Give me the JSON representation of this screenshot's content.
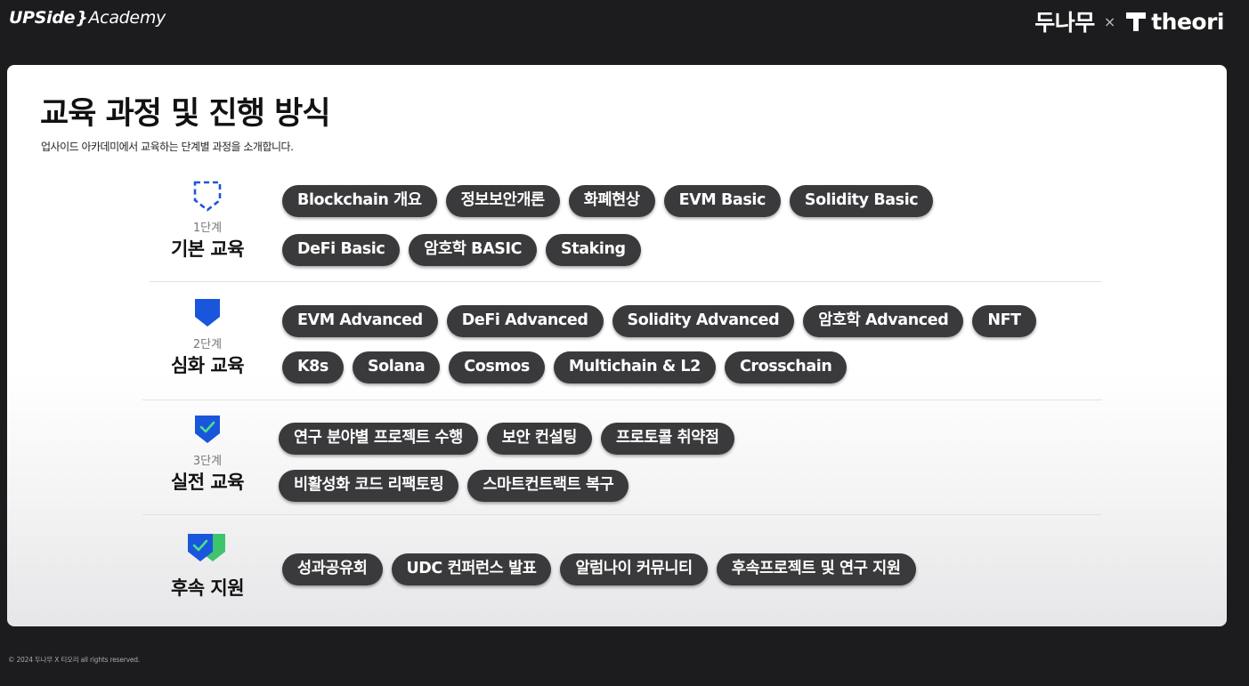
{
  "header": {
    "logo_brand": "UPSide",
    "logo_slash": "}",
    "logo_academy": "Academy",
    "partner_left": "두나무",
    "partner_sep": "×",
    "partner_right": "theori"
  },
  "card": {
    "title": "교육 과정 및 진행 방식",
    "subtitle": "업사이드 아카데미에서 교육하는 단계별 과정을 소개합니다."
  },
  "stages": [
    {
      "step": "1단계",
      "name": "기본 교육",
      "icon": "dashed-shield-icon",
      "rows": [
        [
          "Blockchain 개요",
          "정보보안개론",
          "화폐현상",
          "EVM Basic",
          "Solidity Basic"
        ],
        [
          "DeFi Basic",
          "암호학 BASIC",
          "Staking"
        ]
      ]
    },
    {
      "step": "2단계",
      "name": "심화 교육",
      "icon": "shield-icon",
      "rows": [
        [
          "EVM Advanced",
          "DeFi Advanced",
          "Solidity Advanced",
          "암호학 Advanced",
          "NFT"
        ],
        [
          "K8s",
          "Solana",
          "Cosmos",
          "Multichain & L2",
          "Crosschain"
        ]
      ]
    },
    {
      "step": "3단계",
      "name": "실전 교육",
      "icon": "shield-check-icon",
      "rows": [
        [
          "연구 분야별 프로젝트 수행",
          "보안 컨설팅",
          "프로토콜 취약점"
        ],
        [
          "비활성화 코드 리팩토링",
          "스마트컨트랙트 복구"
        ]
      ]
    },
    {
      "step": "",
      "name": "후속 지원",
      "icon": "double-shield-check-icon",
      "rows": [
        [
          "성과공유회",
          "UDC 컨퍼런스 발표",
          "알럼나이 커뮤니티",
          "후속프로젝트 및 연구 지원"
        ]
      ]
    }
  ],
  "footer": {
    "copyright": "© 2024 두나무 X 티오리 all rights reserved."
  },
  "colors": {
    "background": "#1c1c1e",
    "card": "#ffffff",
    "pill": "#3a3a3c",
    "accent_blue": "#1a56db",
    "accent_green": "#3ec46d"
  }
}
